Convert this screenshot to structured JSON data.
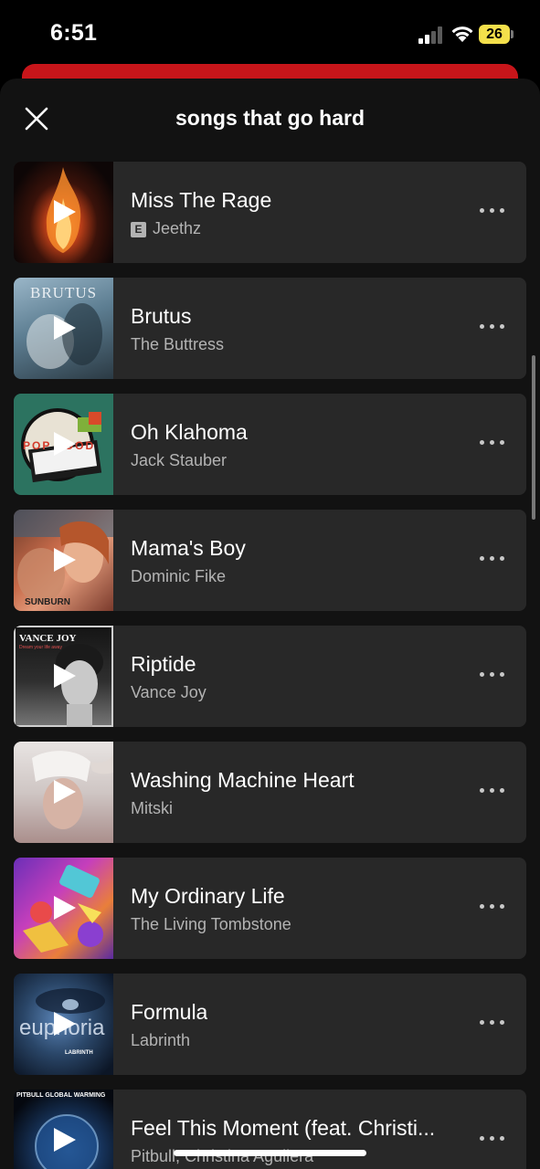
{
  "status_bar": {
    "time": "6:51",
    "battery": "26"
  },
  "sheet": {
    "title": "songs that go hard"
  },
  "tracks": [
    {
      "title": "Miss The Rage",
      "artist": "Jeethz",
      "explicit": true,
      "explicit_label": "E"
    },
    {
      "title": "Brutus",
      "artist": "The Buttress",
      "explicit": false
    },
    {
      "title": "Oh Klahoma",
      "artist": "Jack Stauber",
      "explicit": false
    },
    {
      "title": "Mama's Boy",
      "artist": "Dominic Fike",
      "explicit": false
    },
    {
      "title": "Riptide",
      "artist": "Vance Joy",
      "explicit": false
    },
    {
      "title": "Washing Machine Heart",
      "artist": "Mitski",
      "explicit": false
    },
    {
      "title": "My Ordinary Life",
      "artist": "The Living Tombstone",
      "explicit": false
    },
    {
      "title": "Formula",
      "artist": "Labrinth",
      "explicit": false
    },
    {
      "title": "Feel This Moment (feat. Christi...",
      "artist": "Pitbull, Christina Aguilera",
      "explicit": false
    }
  ],
  "album_art_text": {
    "brutus": "BRUTUS",
    "oh_klahoma": "POP FOOD",
    "mamas_boy": "SUNBURN",
    "riptide": "VANCE JOY",
    "riptide_sub": "Dream your life away",
    "formula": "euphoria",
    "formula_sub": "LABRINTH",
    "feel_this_moment": "PITBULL GLOBAL WARMING"
  },
  "icons": {
    "close": "close-icon",
    "play": "play-icon",
    "more": "more-options-icon",
    "explicit": "explicit-badge"
  },
  "colors": {
    "background": "#121212",
    "row_background": "#282828",
    "subtext": "#b3b3b3",
    "battery": "#f4e04b",
    "strip": "#c7151a"
  }
}
